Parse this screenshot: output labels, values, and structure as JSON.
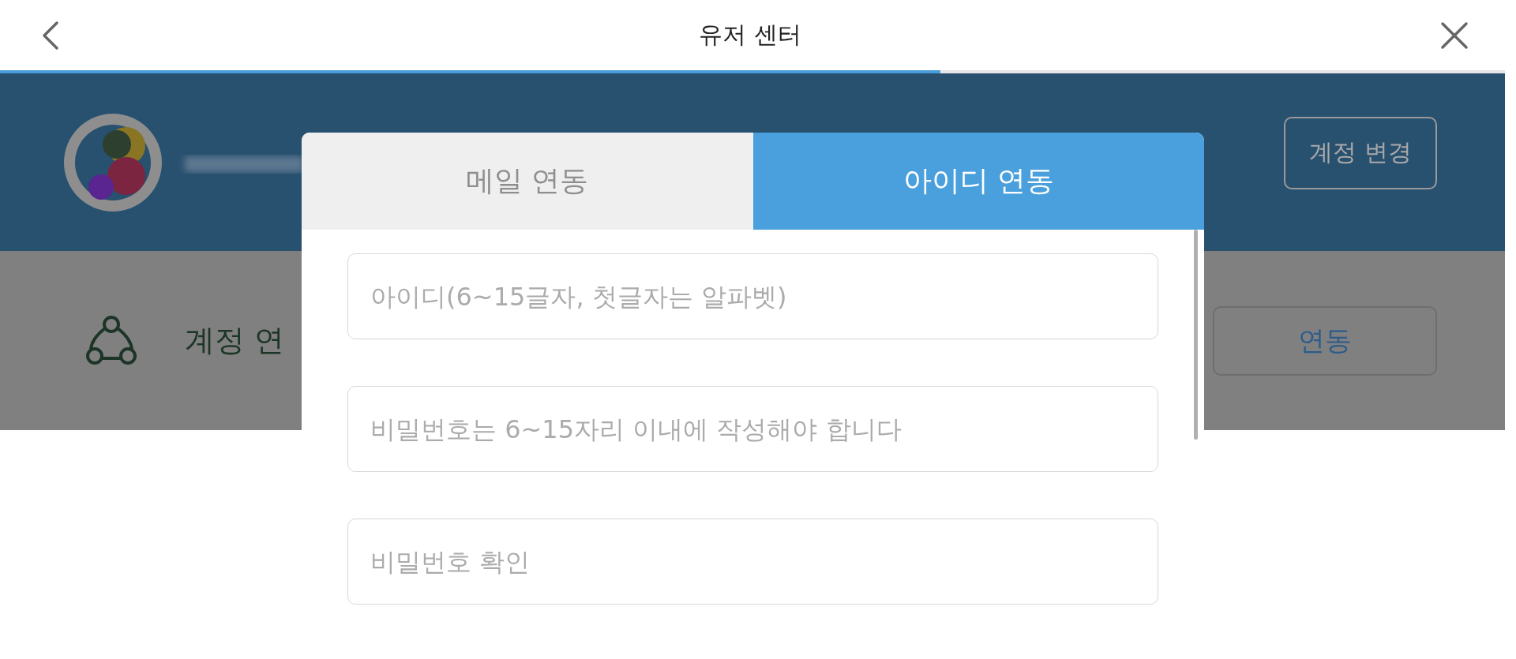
{
  "top_bar": {
    "title": "유저 센터"
  },
  "progress": {
    "level": 0.625
  },
  "profile": {
    "change_account_button": "계정 변경"
  },
  "account_link_row": {
    "label": "계정 연",
    "button": "연동"
  },
  "dialog": {
    "tabs": [
      {
        "label": "메일 연동",
        "selected": false
      },
      {
        "label": "아이디 연동",
        "selected": true
      }
    ],
    "fields": [
      {
        "placeholder": "아이디(6~15글자, 첫글자는 알파벳)"
      },
      {
        "placeholder": "비밀번호는 6~15자리 이내에 작성해야 합니다"
      },
      {
        "placeholder": "비밀번호 확인"
      }
    ]
  }
}
